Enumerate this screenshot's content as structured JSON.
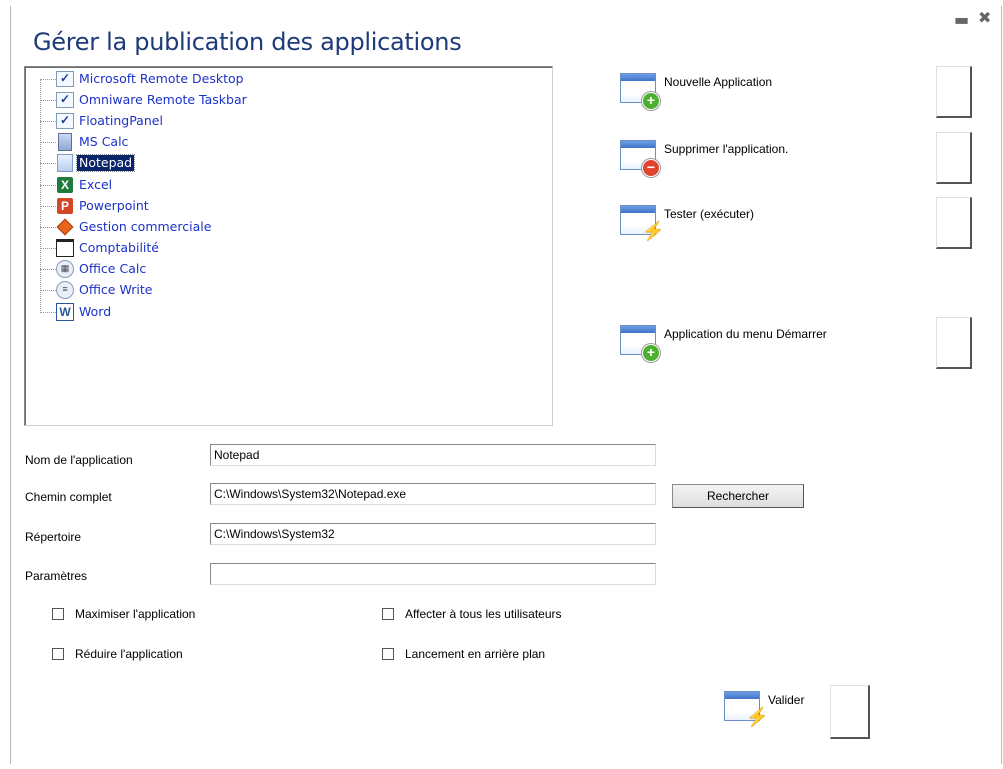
{
  "window": {
    "title": "Gérer la publication des applications",
    "minimize_glyph": "▬",
    "close_glyph": "✖"
  },
  "tree": {
    "items": [
      {
        "label": "Microsoft Remote Desktop",
        "icon": "checkbox-icon",
        "selected": false
      },
      {
        "label": "Omniware Remote Taskbar",
        "icon": "checkbox-icon",
        "selected": false
      },
      {
        "label": "FloatingPanel",
        "icon": "checkbox-icon",
        "selected": false
      },
      {
        "label": "MS Calc",
        "icon": "calculator-icon",
        "selected": false
      },
      {
        "label": "Notepad",
        "icon": "notepad-icon",
        "selected": true
      },
      {
        "label": "Excel",
        "icon": "excel-icon",
        "selected": false
      },
      {
        "label": "Powerpoint",
        "icon": "powerpoint-icon",
        "selected": false
      },
      {
        "label": "Gestion commerciale",
        "icon": "diamond-icon",
        "selected": false
      },
      {
        "label": "Comptabilité",
        "icon": "window-icon",
        "selected": false
      },
      {
        "label": "Office Calc",
        "icon": "office-calc-icon",
        "selected": false
      },
      {
        "label": "Office Write",
        "icon": "office-write-icon",
        "selected": false
      },
      {
        "label": "Word",
        "icon": "word-icon",
        "selected": false
      }
    ]
  },
  "actions": {
    "new_app": "Nouvelle Application",
    "delete_app": "Supprimer l'application.",
    "test_app": "Tester (exécuter)",
    "start_menu_app": "Application du menu Démarrer"
  },
  "form": {
    "name_label": "Nom de l'application",
    "name_value": "Notepad",
    "path_label": "Chemin complet",
    "path_value": "C:\\Windows\\System32\\Notepad.exe",
    "dir_label": "Répertoire",
    "dir_value": "C:\\Windows\\System32",
    "params_label": "Paramètres",
    "params_value": "",
    "search_button": "Rechercher"
  },
  "options": {
    "maximize": "Maximiser l'application",
    "reduce": "Réduire l'application",
    "all_users": "Affecter à tous les utilisateurs",
    "background": "Lancement en arrière plan"
  },
  "footer": {
    "validate": "Valider"
  },
  "colors": {
    "title": "#1e3a78",
    "tree_link": "#1c32c8",
    "selection": "#0a246a"
  }
}
